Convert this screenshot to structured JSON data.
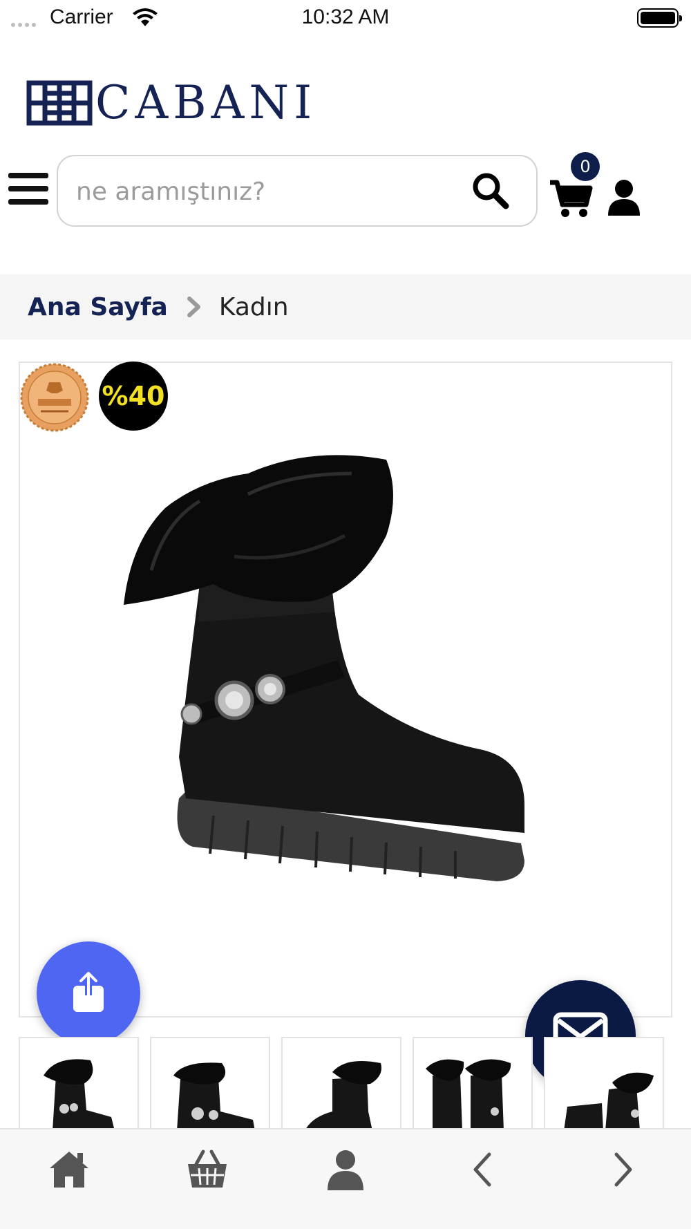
{
  "status_bar": {
    "carrier": "Carrier",
    "time": "10:32 AM"
  },
  "brand": {
    "name": "CABANI",
    "color": "#142254"
  },
  "header": {
    "search_placeholder": "ne aramıştınız?",
    "cart_count": "0",
    "icons": [
      "menu-icon",
      "search-icon",
      "cart-icon",
      "user-icon"
    ]
  },
  "breadcrumb": {
    "home": "Ana Sayfa",
    "current": "Kadın"
  },
  "product": {
    "discount_badge": "%40",
    "leather_badge_text": "LEATHER PREMIUM GRADE SOLE",
    "image": "black-suede-fur-boot",
    "thumbnails": [
      "thumb-1",
      "thumb-2",
      "thumb-3",
      "thumb-4",
      "thumb-5"
    ]
  },
  "colors": {
    "share_fab": "#4f66f3",
    "mail_fab": "#0a1a45",
    "badge": "#0f1d4b"
  },
  "bottom_nav": [
    "home-icon",
    "basket-icon",
    "profile-icon",
    "back-icon",
    "forward-icon"
  ]
}
